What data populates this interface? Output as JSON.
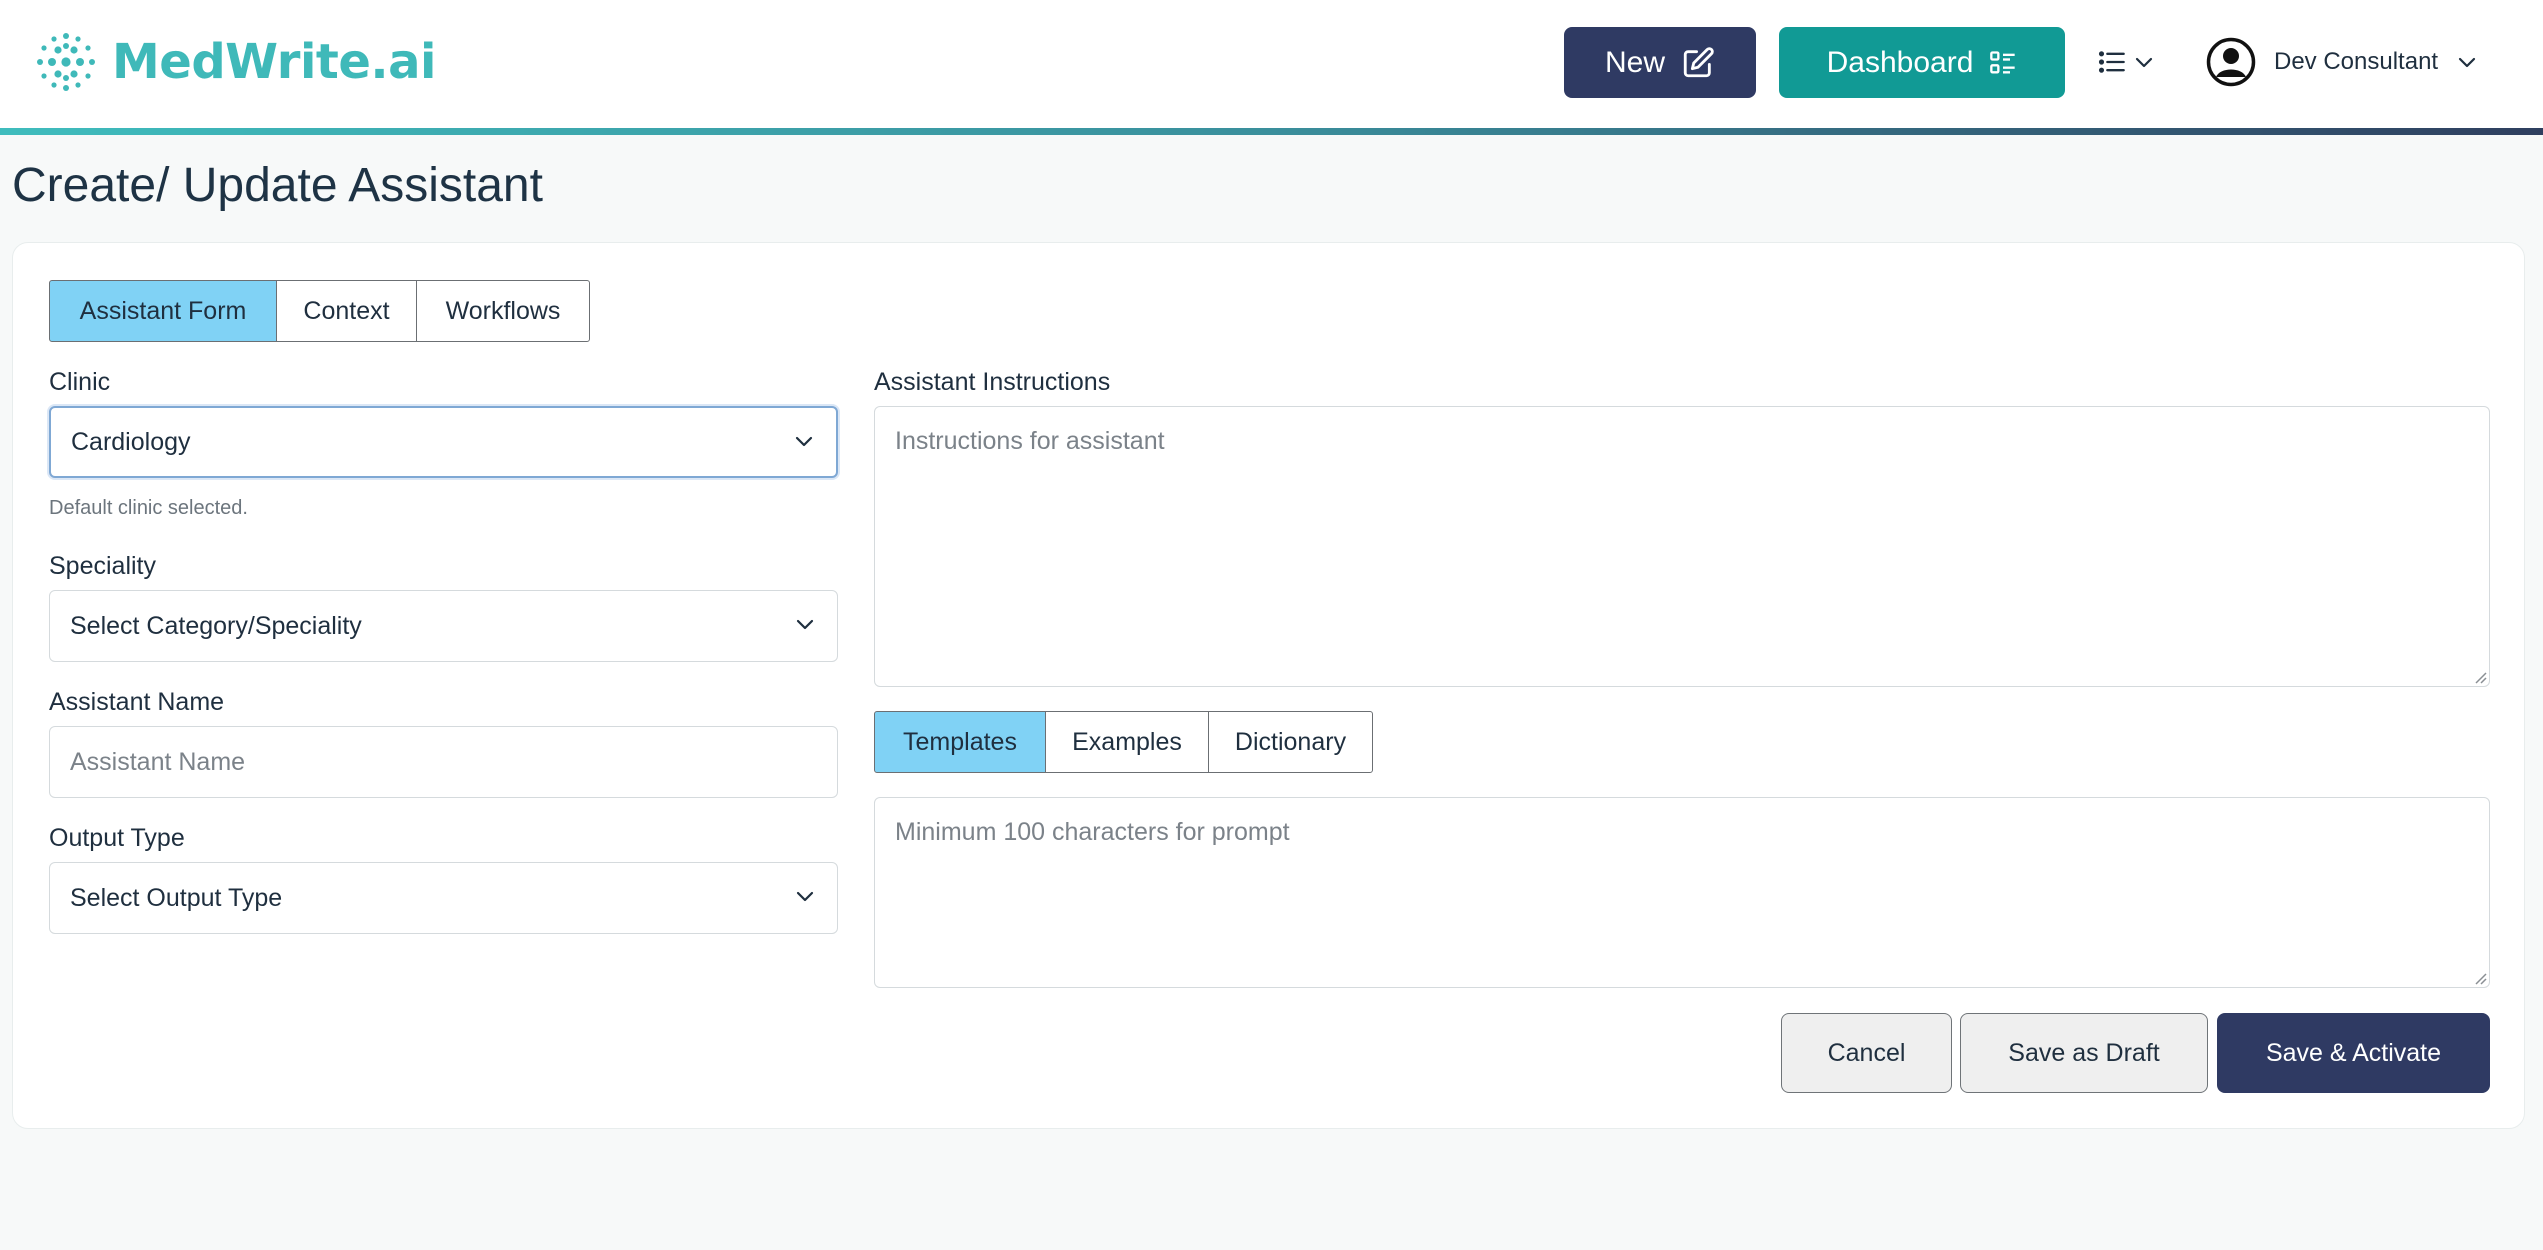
{
  "header": {
    "brand": "MedWrite.ai",
    "new_label": "New",
    "dashboard_label": "Dashboard",
    "user_name": "Dev Consultant"
  },
  "page": {
    "title": "Create/ Update Assistant"
  },
  "main_tabs": [
    {
      "label": "Assistant Form",
      "active": true
    },
    {
      "label": "Context",
      "active": false
    },
    {
      "label": "Workflows",
      "active": false
    }
  ],
  "form": {
    "clinic": {
      "label": "Clinic",
      "value": "Cardiology",
      "helper": "Default clinic selected."
    },
    "speciality": {
      "label": "Speciality",
      "value": "Select Category/Speciality"
    },
    "assistant_name": {
      "label": "Assistant Name",
      "placeholder": "Assistant Name"
    },
    "output_type": {
      "label": "Output Type",
      "value": "Select Output Type"
    },
    "instructions": {
      "label": "Assistant Instructions",
      "placeholder": "Instructions for assistant"
    },
    "prompt": {
      "placeholder": "Minimum 100 characters for prompt"
    }
  },
  "sub_tabs": [
    {
      "label": "Templates",
      "active": true
    },
    {
      "label": "Examples",
      "active": false
    },
    {
      "label": "Dictionary",
      "active": false
    }
  ],
  "actions": {
    "cancel": "Cancel",
    "save_draft": "Save as Draft",
    "save_activate": "Save & Activate"
  },
  "colors": {
    "brand_teal": "#3fb9b9",
    "navy": "#2f3a63",
    "dashboard_teal": "#119a95",
    "active_tab": "#80d2f5"
  }
}
